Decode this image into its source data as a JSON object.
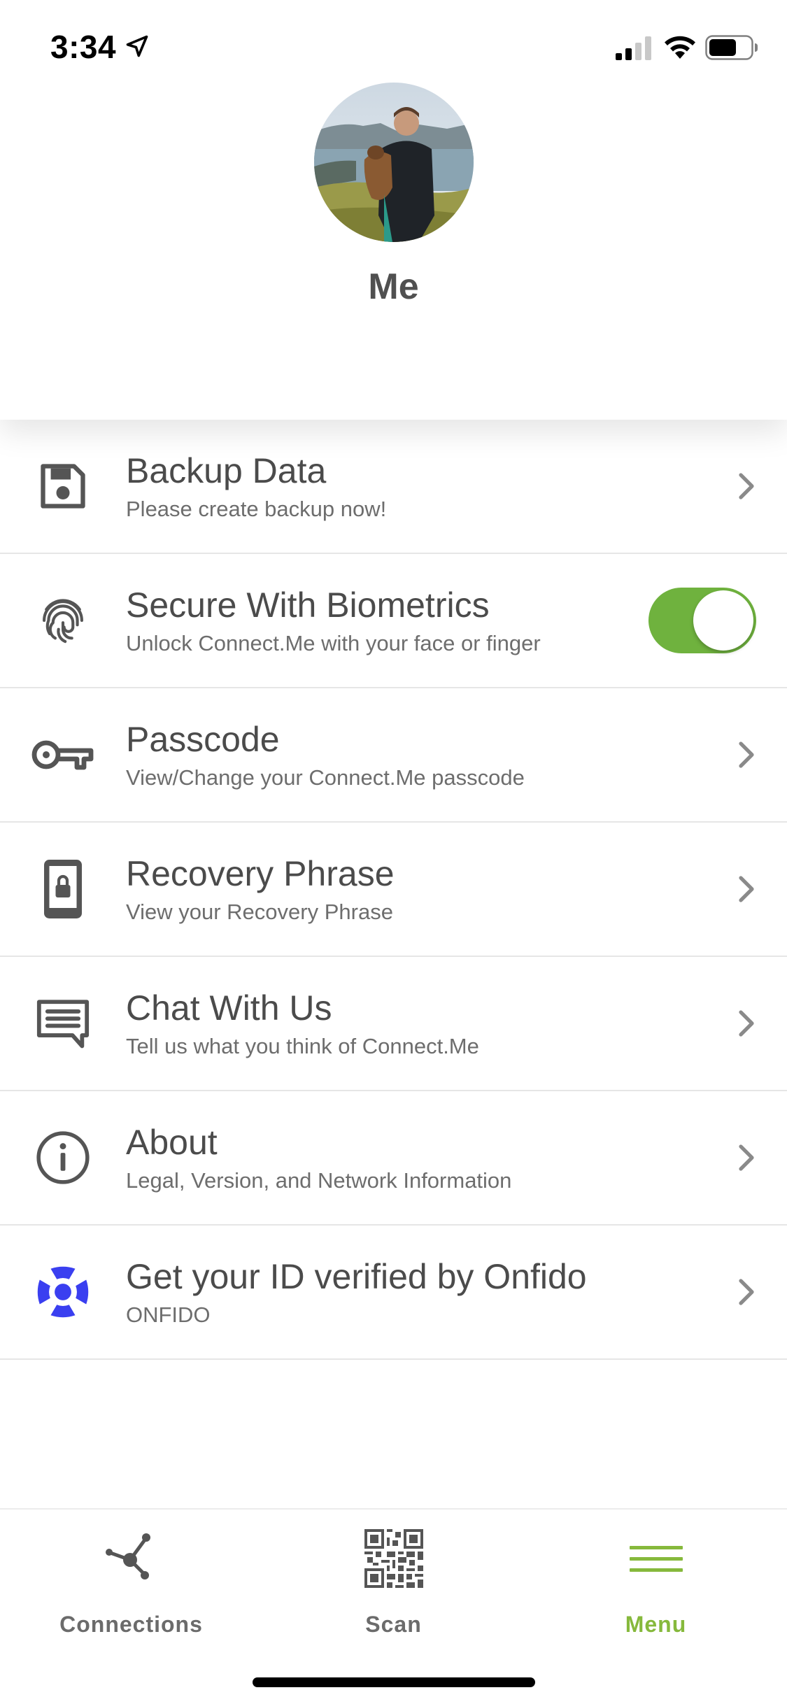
{
  "status_bar": {
    "time": "3:34",
    "icons": [
      "location-arrow-icon",
      "cellular-signal-icon",
      "wifi-icon",
      "battery-icon"
    ]
  },
  "profile": {
    "name": "Me",
    "avatar": "profile-photo"
  },
  "menu": [
    {
      "title": "Backup Data",
      "subtitle": "Please create backup now!",
      "icon": "save-icon",
      "control": "chevron"
    },
    {
      "title": "Secure With Biometrics",
      "subtitle": "Unlock Connect.Me with your face or finger",
      "icon": "fingerprint-icon",
      "control": "toggle",
      "toggle_on": true
    },
    {
      "title": "Passcode",
      "subtitle": "View/Change your Connect.Me passcode",
      "icon": "key-icon",
      "control": "chevron"
    },
    {
      "title": "Recovery Phrase",
      "subtitle": "View your Recovery Phrase",
      "icon": "phone-lock-icon",
      "control": "chevron"
    },
    {
      "title": "Chat With Us",
      "subtitle": "Tell us what you think of Connect.Me",
      "icon": "chat-icon",
      "control": "chevron"
    },
    {
      "title": "About",
      "subtitle": "Legal, Version, and Network Information",
      "icon": "info-icon",
      "control": "chevron"
    },
    {
      "title": "Get your ID verified by Onfido",
      "subtitle": "ONFIDO",
      "icon": "onfido-logo-icon",
      "control": "chevron"
    }
  ],
  "tabs": [
    {
      "label": "Connections",
      "icon": "connections-icon",
      "active": false
    },
    {
      "label": "Scan",
      "icon": "qr-code-icon",
      "active": false
    },
    {
      "label": "Menu",
      "icon": "hamburger-menu-icon",
      "active": true
    }
  ],
  "colors": {
    "accent": "#86b93c",
    "toggle_on": "#6fb23e",
    "icon_gray": "#555555",
    "onfido_blue": "#3a3ff0"
  }
}
